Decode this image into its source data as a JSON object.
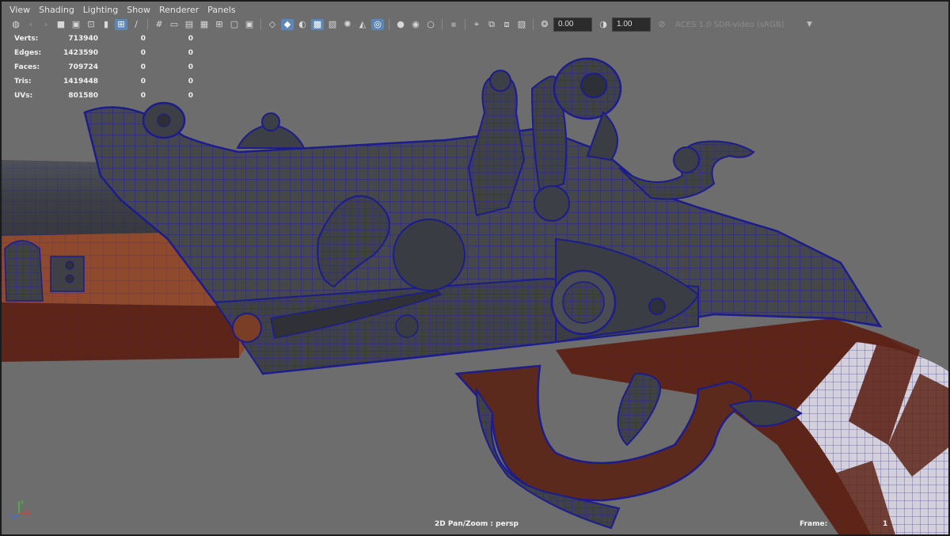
{
  "menu": [
    "View",
    "Shading",
    "Lighting",
    "Show",
    "Renderer",
    "Panels"
  ],
  "toolbar": {
    "exposure_value": "0.00",
    "gamma_value": "1.00",
    "color_space": "ACES 1.0 SDR-video (sRGB)"
  },
  "hud": {
    "rows": [
      {
        "label": "Verts:",
        "values": [
          "713940",
          "0",
          "0"
        ]
      },
      {
        "label": "Edges:",
        "values": [
          "1423590",
          "0",
          "0"
        ]
      },
      {
        "label": "Faces:",
        "values": [
          "709724",
          "0",
          "0"
        ]
      },
      {
        "label": "Tris:",
        "values": [
          "1419448",
          "0",
          "0"
        ]
      },
      {
        "label": "UVs:",
        "values": [
          "801580",
          "0",
          "0"
        ]
      }
    ]
  },
  "viewport": {
    "camera_label": "2D Pan/Zoom : persp",
    "frame_label": "Frame:",
    "frame_value": "1",
    "axis_labels": {
      "y": "y",
      "x": "x",
      "z": "z"
    }
  },
  "colors": {
    "viewport_bg": "#6d6d6d",
    "wire": "#1f1f9e",
    "metal": "#45474d",
    "wood": "#6b2a1d",
    "wood_light": "#a8623d",
    "active_tool": "#5e87b5"
  },
  "icons": [
    "select-camera-icon",
    "camera-icon",
    "camera-attributes-icon",
    "bookmark-icon",
    "image-plane-icon",
    "grid-icon",
    "film-gate-icon",
    "resolution-gate-icon",
    "gate-mask-icon",
    "field-chart-icon",
    "safe-action-icon",
    "safe-title-icon",
    "wireframe-icon",
    "smooth-shade-icon",
    "default-material-icon",
    "textured-icon",
    "use-lights-icon",
    "shadows-icon",
    "ssao-icon",
    "motion-blur-icon",
    "anti-alias-icon",
    "depth-of-field-icon",
    "isolate-select-icon",
    "xray-icon",
    "xray-joints-icon",
    "xray-active-icon",
    "backface-icon",
    "exposure-icon",
    "gamma-icon",
    "color-management-icon"
  ]
}
